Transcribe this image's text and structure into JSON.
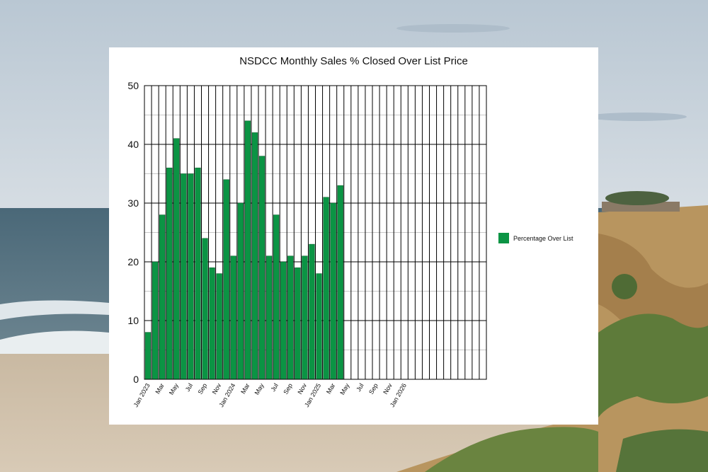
{
  "colors": {
    "bar": "#0b9444",
    "bar_edge": "#0a5c2a",
    "grid": "#000000",
    "minor_grid": "#c8c8c8",
    "panel": "#ffffff",
    "sky": "#c6d2dc",
    "ocean": "#3f5f72",
    "sand": "#cdbda6",
    "cliff": "#b99660",
    "vegetation": "#5c7a38"
  },
  "chart_data": {
    "type": "bar",
    "title": "NSDCC Monthly Sales % Closed Over List Price",
    "xlabel": "",
    "ylabel": "",
    "ylim": [
      0,
      50
    ],
    "y_ticks": [
      "0",
      "10",
      "20",
      "30",
      "40",
      "50"
    ],
    "x_tick_labels": [
      "Jan 2023",
      "Mar",
      "May",
      "Jul",
      "Sep",
      "Nov",
      "Jan 2024",
      "Mar",
      "May",
      "Jul",
      "Sep",
      "Nov",
      "Jan 2025",
      "Mar",
      "May",
      "Jul",
      "Sep",
      "Nov",
      "Jan 2026"
    ],
    "categories": [
      "Jan 2023",
      "Feb 2023",
      "Mar 2023",
      "Apr 2023",
      "May 2023",
      "Jun 2023",
      "Jul 2023",
      "Aug 2023",
      "Sep 2023",
      "Oct 2023",
      "Nov 2023",
      "Dec 2023",
      "Jan 2024",
      "Feb 2024",
      "Mar 2024",
      "Apr 2024",
      "May 2024",
      "Jun 2024",
      "Jul 2024",
      "Aug 2024",
      "Sep 2024",
      "Oct 2024",
      "Nov 2024",
      "Dec 2024",
      "Jan 2025",
      "Feb 2025",
      "Mar 2025",
      "Apr 2025",
      "May 2025",
      "Jun 2025",
      "Jul 2025",
      "Aug 2025",
      "Sep 2025",
      "Oct 2025",
      "Nov 2025",
      "Dec 2025",
      "Jan 2026",
      "Feb 2026",
      "Mar 2026",
      "Apr 2026",
      "May 2026",
      "Jun 2026",
      "Jul 2026",
      "Aug 2026",
      "Sep 2026",
      "Oct 2026",
      "Nov 2026",
      "Dec 2026"
    ],
    "series": [
      {
        "name": "Percentage Over List",
        "values": [
          8,
          20,
          28,
          36,
          41,
          35,
          35,
          36,
          24,
          19,
          18,
          34,
          21,
          30,
          44,
          42,
          38,
          21,
          28,
          20,
          21,
          19,
          21,
          23,
          18,
          31,
          30,
          33
        ]
      }
    ],
    "grid": true,
    "legend": "right"
  }
}
